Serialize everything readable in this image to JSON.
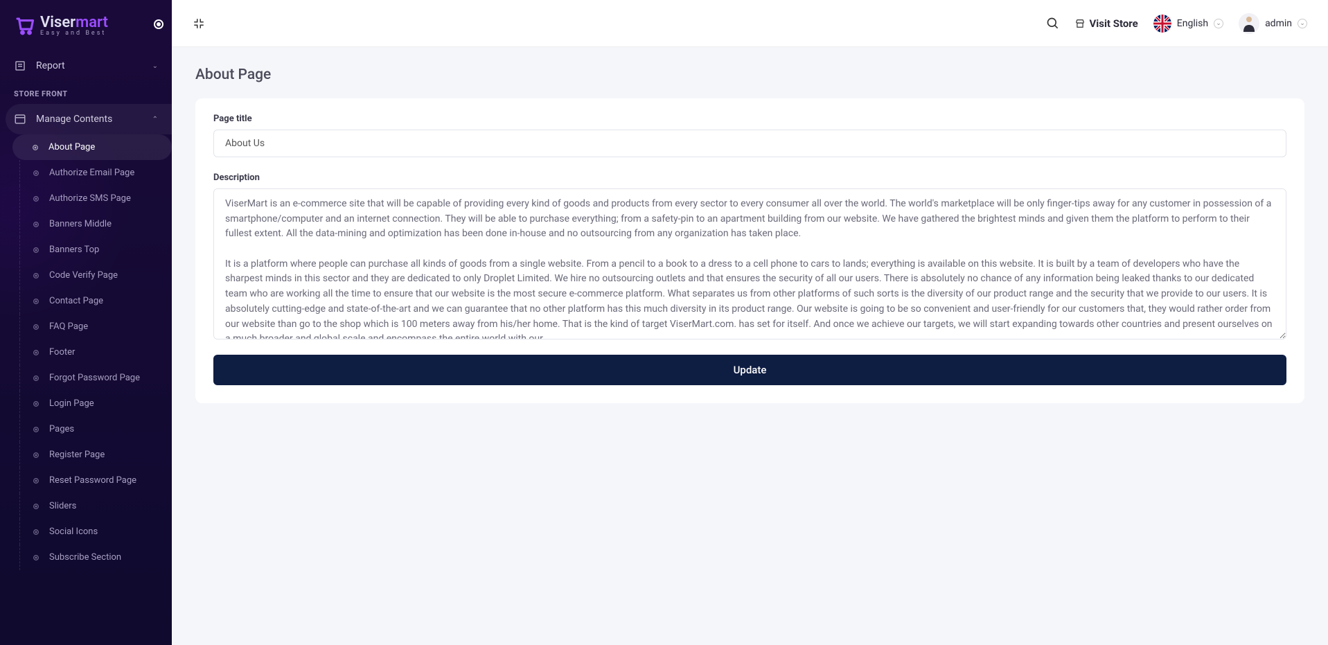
{
  "brand": {
    "name_1": "Viser",
    "name_2": "mart",
    "tagline": "Easy and Best"
  },
  "sidebar": {
    "report_label": "Report",
    "section_heading": "STORE FRONT",
    "manage_contents_label": "Manage Contents",
    "items": [
      {
        "label": "About Page",
        "active": true
      },
      {
        "label": "Authorize Email Page",
        "active": false
      },
      {
        "label": "Authorize SMS Page",
        "active": false
      },
      {
        "label": "Banners Middle",
        "active": false
      },
      {
        "label": "Banners Top",
        "active": false
      },
      {
        "label": "Code Verify Page",
        "active": false
      },
      {
        "label": "Contact Page",
        "active": false
      },
      {
        "label": "FAQ Page",
        "active": false
      },
      {
        "label": "Footer",
        "active": false
      },
      {
        "label": "Forgot Password Page",
        "active": false
      },
      {
        "label": "Login Page",
        "active": false
      },
      {
        "label": "Pages",
        "active": false
      },
      {
        "label": "Register Page",
        "active": false
      },
      {
        "label": "Reset Password Page",
        "active": false
      },
      {
        "label": "Sliders",
        "active": false
      },
      {
        "label": "Social Icons",
        "active": false
      },
      {
        "label": "Subscribe Section",
        "active": false
      }
    ]
  },
  "topbar": {
    "visit_store": "Visit Store",
    "language": "English",
    "username": "admin"
  },
  "page": {
    "title": "About Page",
    "form": {
      "title_label": "Page title",
      "title_value": "About Us",
      "description_label": "Description",
      "description_value": "ViserMart is an e-commerce site that will be capable of providing every kind of goods and products from every sector to every consumer all over the world. The world's marketplace will be only finger-tips away for any customer in possession of a smartphone/computer and an internet connection. They will be able to purchase everything; from a safety-pin to an apartment building from our website. We have gathered the brightest minds and given them the platform to perform to their fullest extent. All the data-mining and optimization has been done in-house and no outsourcing from any organization has taken place.\n\nIt is a platform where people can purchase all kinds of goods from a single website. From a pencil to a book to a dress to a cell phone to cars to lands; everything is available on this website. It is built by a team of developers who have the sharpest minds in this sector and they are dedicated to only Droplet Limited. We hire no outsourcing outlets and that ensures the security of all our users. There is absolutely no chance of any information being leaked thanks to our dedicated team who are working all the time to ensure that our website is the most secure e-commerce platform. What separates us from other platforms of such sorts is the diversity of our product range and the security that we provide to our users. It is absolutely cutting-edge and state-of-the-art and we can guarantee that no other platform has this much diversity in its product range. Our website is going to be so convenient and user-friendly for our customers that, they would rather order from our website than go to the shop which is 100 meters away from his/her home. That is the kind of target ViserMart.com. has set for itself. And once we achieve our targets, we will start expanding towards other countries and present ourselves on a much broader and global scale and encompass the entire world with our",
      "submit_label": "Update"
    }
  }
}
